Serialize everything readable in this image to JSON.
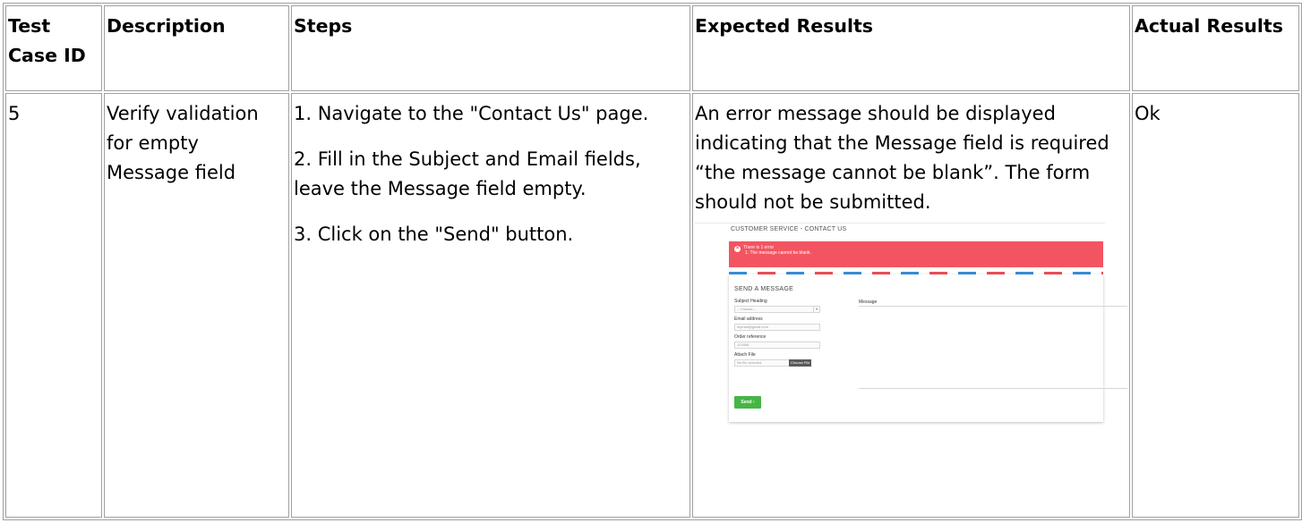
{
  "table": {
    "headers": {
      "test_case_id": "Test Case ID",
      "description": "Description",
      "steps": "Steps",
      "expected": "Expected Results",
      "actual": "Actual Results"
    },
    "row": {
      "test_case_id": "5",
      "description": "Verify validation for empty Message field",
      "steps": [
        "1. Navigate to the \"Contact Us\" page.",
        "2. Fill in the Subject and Email fields, leave the Message field empty.",
        "3. Click on the \"Send\" button."
      ],
      "expected": "An error message should be displayed indicating that the Message field is required “the message cannot be blank”. The form should not be submitted.",
      "actual": "Ok"
    }
  },
  "screenshot": {
    "breadcrumb": "CUSTOMER SERVICE - CONTACT US",
    "alert_title": "There is 1 error",
    "alert_item": "1. The message cannot be blank.",
    "alert_color": "#f25561",
    "section_title": "SEND A MESSAGE",
    "subject_label": "Subject Heading",
    "subject_value": "-- Choose --",
    "email_label": "Email address",
    "email_value": "mymail@gmail.com",
    "order_label": "Order reference",
    "order_value": "123456",
    "attach_label": "Attach File",
    "attach_value": "No file selected",
    "choose_file_label": "Choose File",
    "message_label": "Message",
    "send_label": "Send ›",
    "send_color": "#46b547"
  }
}
